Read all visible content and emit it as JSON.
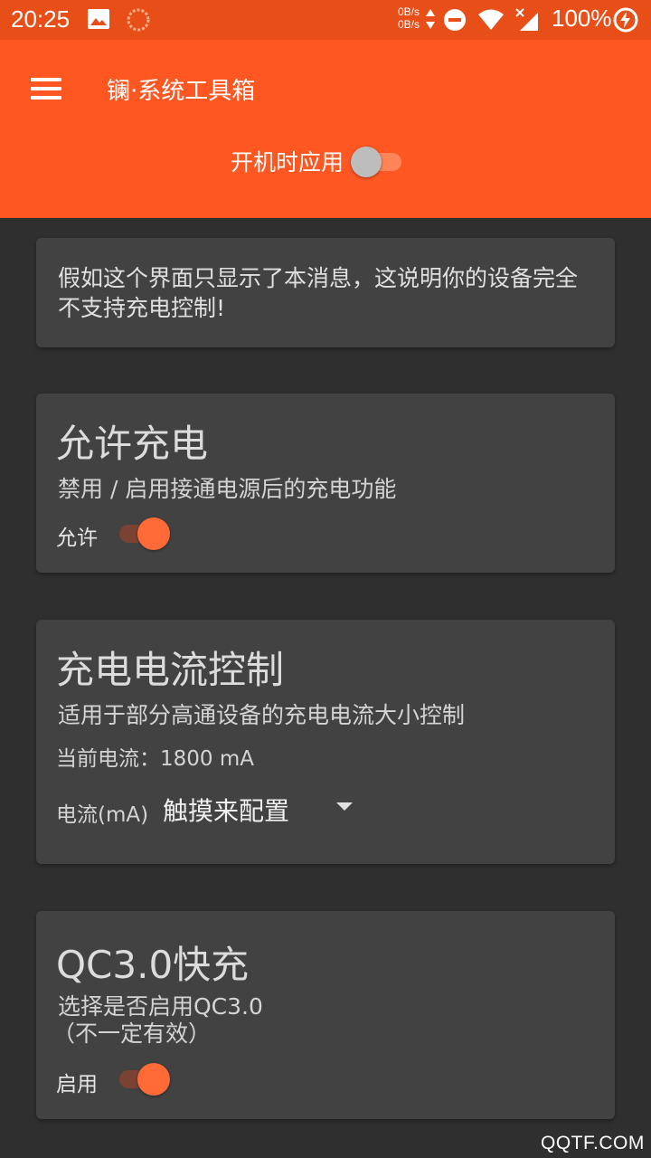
{
  "status_bar": {
    "time": "20:25",
    "net_up": "0B/s",
    "net_down": "0B/s",
    "battery": "100%",
    "icons": [
      "image-icon",
      "loading-icon",
      "data-arrows-icon",
      "dnd-icon",
      "wifi-icon",
      "signal-icon",
      "charging-icon"
    ]
  },
  "app_bar": {
    "title": "镧·系统工具箱",
    "boot_apply_label": "开机时应用",
    "boot_apply_on": false,
    "accent": "#fe5722"
  },
  "notice": {
    "text": "假如这个界面只显示了本消息，这说明你的设备完全不支持充电控制!"
  },
  "allow_charge": {
    "title": "允许充电",
    "desc": "禁用 / 启用接通电源后的充电功能",
    "switch_label": "允许",
    "on": true
  },
  "current_control": {
    "title": "充电电流控制",
    "desc": "适用于部分高通设备的充电电流大小控制",
    "current_text": "当前电流：1800 mA",
    "field_label": "电流(mA)",
    "field_value": "触摸来配置"
  },
  "qc3": {
    "title": "QC3.0快充",
    "desc_line1": "选择是否启用QC3.0",
    "desc_line2": "（不一定有效）",
    "switch_label": "启用",
    "on": true
  },
  "watermark": "QQTF.COM"
}
